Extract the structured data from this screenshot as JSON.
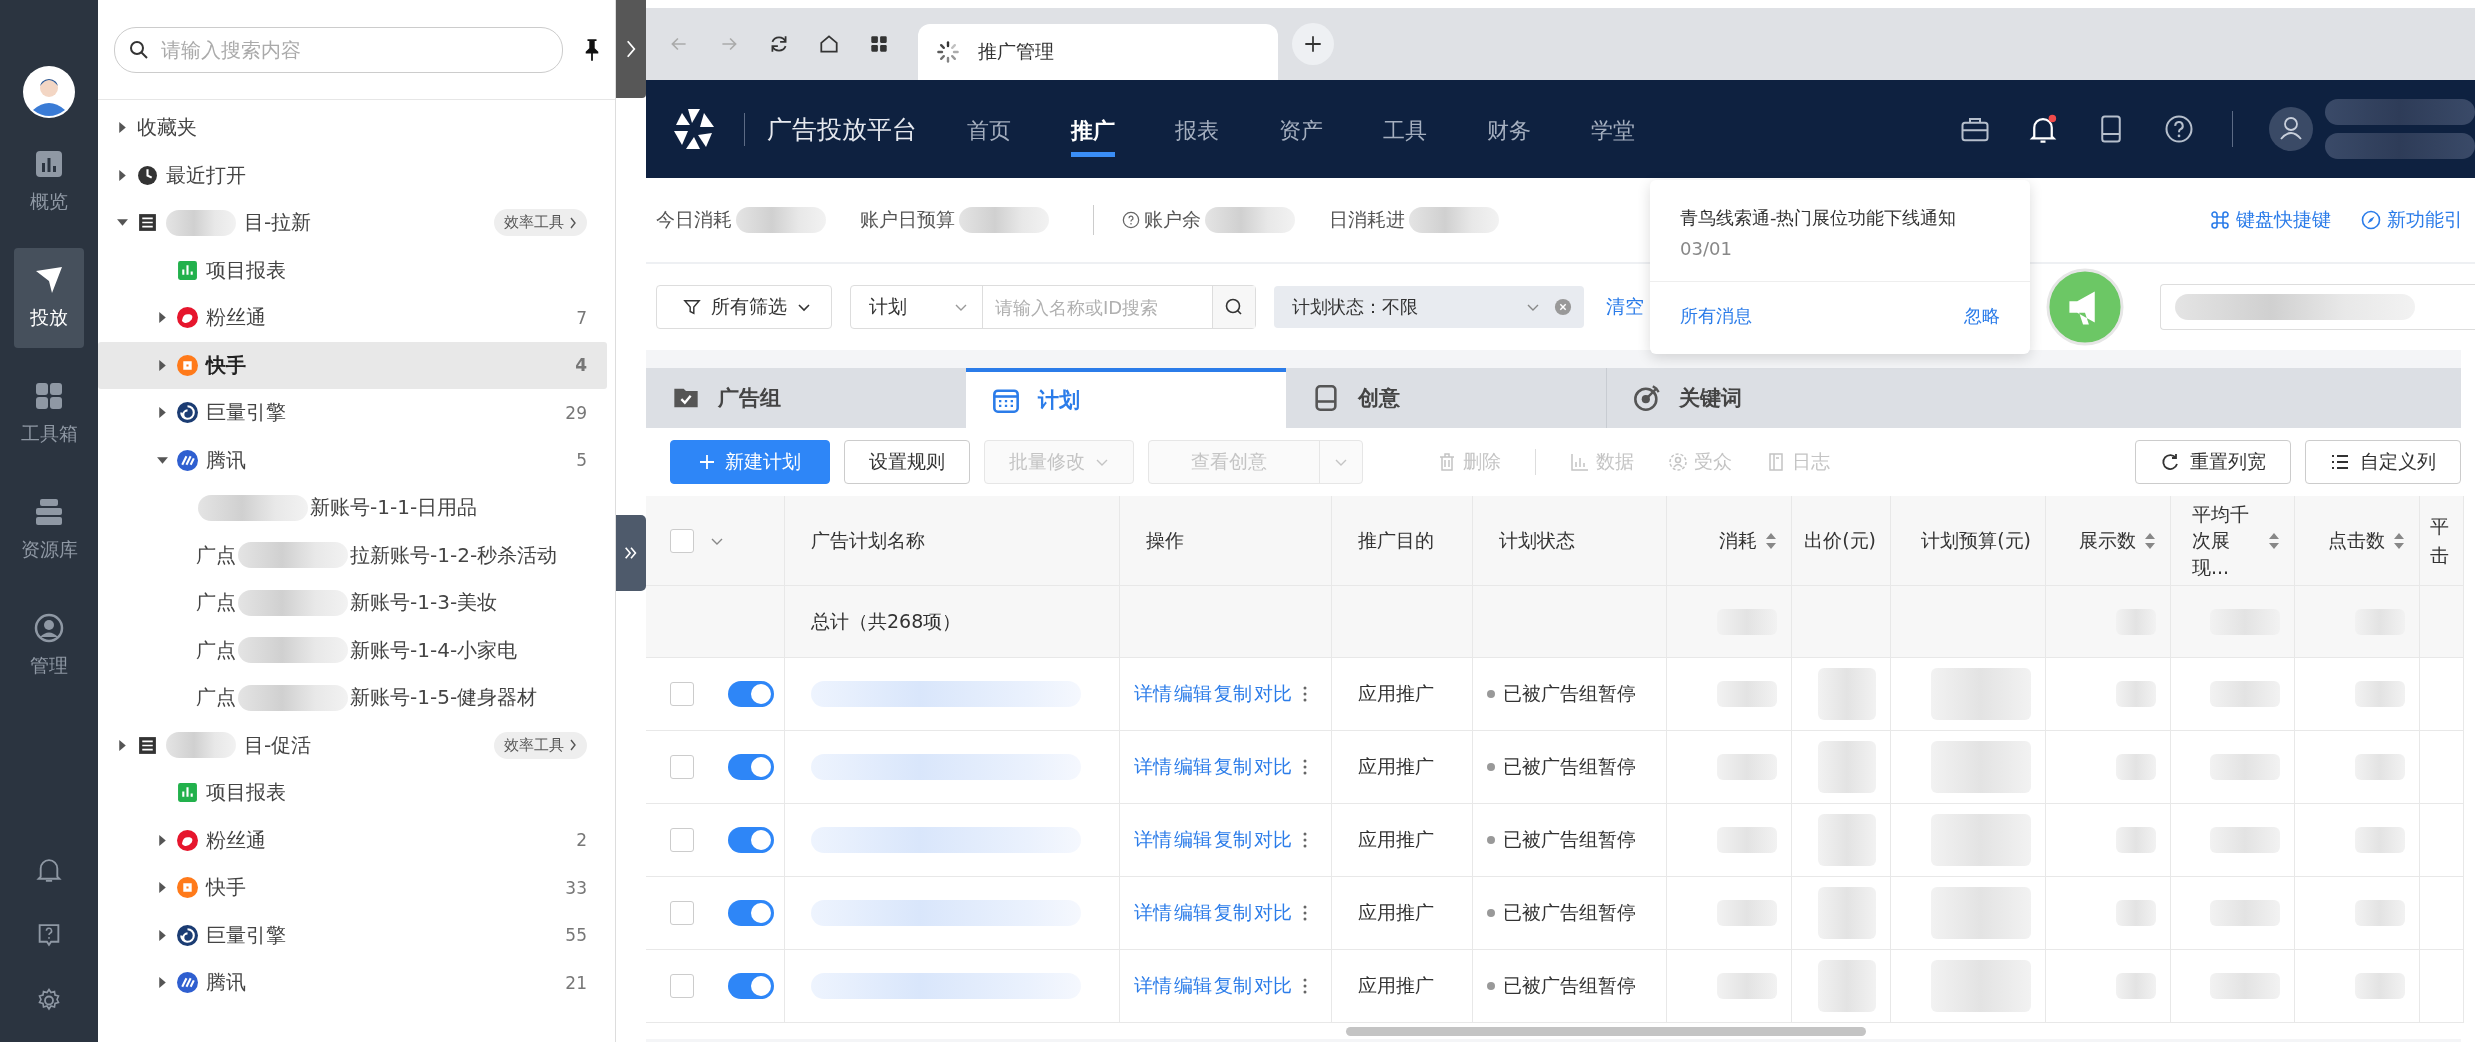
{
  "rail": {
    "items": [
      {
        "label": "概览",
        "kind": "overview",
        "selected": false
      },
      {
        "label": "投放",
        "kind": "deliver",
        "selected": true
      },
      {
        "label": "工具箱",
        "kind": "tools",
        "selected": false
      },
      {
        "label": "资源库",
        "kind": "library",
        "selected": false
      },
      {
        "label": "管理",
        "kind": "manage",
        "selected": false
      }
    ]
  },
  "tree": {
    "search": {
      "placeholder": "请输入搜索内容"
    },
    "items": [
      {
        "label": "收藏夹",
        "kind": "folder",
        "expanded": false,
        "selected": false
      },
      {
        "label": "最近打开",
        "kind": "recent",
        "expanded": false,
        "selected": false
      },
      {
        "label": "目-拉新",
        "kind": "project",
        "expanded": true,
        "selected": false,
        "badge": "效率工具",
        "children": [
          {
            "label": "项目报表",
            "kind": "report",
            "selected": false
          },
          {
            "label": "粉丝通",
            "kind": "weibo",
            "expanded": false,
            "selected": false,
            "count": "7"
          },
          {
            "label": "快手",
            "kind": "kuaishou",
            "expanded": false,
            "selected": true,
            "count": "4"
          },
          {
            "label": "巨量引擎",
            "kind": "ocean",
            "expanded": false,
            "selected": false,
            "count": "29"
          },
          {
            "label": "腾讯",
            "kind": "tencent",
            "expanded": true,
            "selected": false,
            "count": "5",
            "children": [
              {
                "label": "新账号-1-1-日用品",
                "kind": "account",
                "selected": false
              },
              {
                "prefix": "广点",
                "label": "拉新账号-1-2-秒杀活动",
                "kind": "account",
                "selected": false
              },
              {
                "prefix": "广点",
                "label": "新账号-1-3-美妆",
                "kind": "account",
                "selected": false
              },
              {
                "prefix": "广点",
                "label": "新账号-1-4-小家电",
                "kind": "account",
                "selected": false
              },
              {
                "prefix": "广点",
                "label": "新账号-1-5-健身器材",
                "kind": "account",
                "selected": false
              }
            ]
          }
        ]
      },
      {
        "label": "目-促活",
        "kind": "project",
        "expanded": false,
        "selected": false,
        "badge": "效率工具",
        "children": [
          {
            "label": "项目报表",
            "kind": "report",
            "selected": false
          },
          {
            "label": "粉丝通",
            "kind": "weibo",
            "expanded": false,
            "selected": false,
            "count": "2"
          },
          {
            "label": "快手",
            "kind": "kuaishou",
            "expanded": false,
            "selected": false,
            "count": "33"
          },
          {
            "label": "巨量引擎",
            "kind": "ocean",
            "expanded": false,
            "selected": false,
            "count": "55"
          },
          {
            "label": "腾讯",
            "kind": "tencent",
            "expanded": false,
            "selected": false,
            "count": "21"
          }
        ]
      }
    ]
  },
  "browser": {
    "tab": {
      "title": "推广管理",
      "loading": true
    }
  },
  "nav": {
    "brand": "广告投放平台",
    "items": [
      {
        "label": "首页",
        "selected": false
      },
      {
        "label": "推广",
        "selected": true
      },
      {
        "label": "报表",
        "selected": false
      },
      {
        "label": "资产",
        "selected": false
      },
      {
        "label": "工具",
        "selected": false
      },
      {
        "label": "财务",
        "selected": false
      },
      {
        "label": "学堂",
        "selected": false
      }
    ],
    "unread": true
  },
  "stats": [
    {
      "label": "今日消耗",
      "kind": "plain"
    },
    {
      "label": "账户日预算",
      "kind": "plain"
    },
    {
      "label": "账户余",
      "kind": "help"
    },
    {
      "label": "日消耗进",
      "kind": "plain"
    }
  ],
  "links": [
    {
      "label": "键盘快捷键",
      "kind": "shortcut"
    },
    {
      "label": "新功能引",
      "kind": "guide"
    }
  ],
  "notification": {
    "title": "青鸟线索通-热门展位功能下线通知",
    "date": "03/01",
    "all": "所有消息",
    "ignore": "忽略"
  },
  "filters": {
    "all": "所有筛选",
    "scope": "计划",
    "search": {
      "placeholder": "请输入名称或ID搜索"
    },
    "status_chip": "计划状态：不限",
    "clear": "清空"
  },
  "tabs": [
    {
      "label": "广告组",
      "kind": "group",
      "selected": false
    },
    {
      "label": "计划",
      "kind": "plan",
      "selected": true
    },
    {
      "label": "创意",
      "kind": "creative",
      "selected": false
    },
    {
      "label": "关键词",
      "kind": "keyword",
      "selected": false
    }
  ],
  "toolbar": {
    "buttons": [
      {
        "label": "新建计划",
        "kind": "primary",
        "disabled": false
      },
      {
        "label": "设置规则",
        "kind": "default",
        "disabled": false
      },
      {
        "label": "批量修改",
        "kind": "dropdown",
        "disabled": true
      },
      {
        "label": "查看创意",
        "kind": "split",
        "disabled": true
      }
    ],
    "actions": [
      {
        "label": "删除",
        "kind": "delete",
        "disabled": true
      },
      {
        "label": "数据",
        "kind": "data",
        "disabled": true
      },
      {
        "label": "受众",
        "kind": "audience",
        "disabled": true
      },
      {
        "label": "日志",
        "kind": "log",
        "disabled": true
      }
    ],
    "right": [
      {
        "label": "重置列宽",
        "kind": "reset"
      },
      {
        "label": "自定义列",
        "kind": "columns"
      }
    ]
  },
  "table": {
    "select_all": {
      "checked": false
    },
    "columns": [
      {
        "kind": "select"
      },
      {
        "label": "广告计划名称",
        "kind": "name"
      },
      {
        "label": "操作",
        "kind": "actions"
      },
      {
        "label": "推广目的",
        "kind": "purpose"
      },
      {
        "label": "计划状态",
        "kind": "status"
      },
      {
        "label": "消耗",
        "kind": "metric",
        "sortable": true
      },
      {
        "label": "出价(元)",
        "kind": "metric",
        "sortable": false
      },
      {
        "label": "计划预算(元)",
        "kind": "metric",
        "sortable": false
      },
      {
        "label": "展示数",
        "kind": "metric",
        "sortable": true
      },
      {
        "label": "平均千次展现...",
        "kind": "metric",
        "sortable": true
      },
      {
        "label": "点击数",
        "kind": "metric",
        "sortable": true
      },
      {
        "label": "平击",
        "kind": "metric",
        "sortable": false
      }
    ],
    "total": {
      "label": "总计（共268项）"
    },
    "rows": [
      {
        "checked": false,
        "enabled": true,
        "actions": [
          "详情",
          "编辑",
          "复制",
          "对比"
        ],
        "purpose": "应用推广",
        "status": "已被广告组暂停"
      },
      {
        "checked": false,
        "enabled": true,
        "actions": [
          "详情",
          "编辑",
          "复制",
          "对比"
        ],
        "purpose": "应用推广",
        "status": "已被广告组暂停"
      },
      {
        "checked": false,
        "enabled": true,
        "actions": [
          "详情",
          "编辑",
          "复制",
          "对比"
        ],
        "purpose": "应用推广",
        "status": "已被广告组暂停"
      },
      {
        "checked": false,
        "enabled": true,
        "actions": [
          "详情",
          "编辑",
          "复制",
          "对比"
        ],
        "purpose": "应用推广",
        "status": "已被广告组暂停"
      },
      {
        "checked": false,
        "enabled": true,
        "actions": [
          "详情",
          "编辑",
          "复制",
          "对比"
        ],
        "purpose": "应用推广",
        "status": "已被广告组暂停"
      }
    ]
  }
}
